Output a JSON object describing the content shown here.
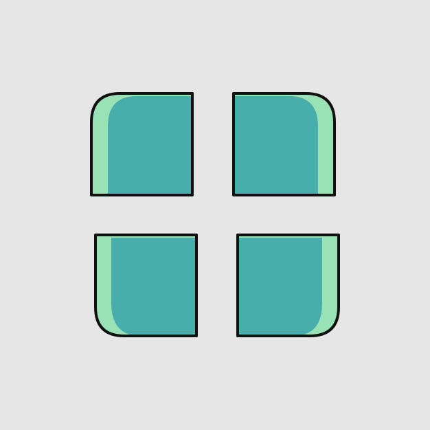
{
  "background_color": "#e6e6e6",
  "icon": {
    "name": "grid-window-icon",
    "colors": {
      "fill_primary": "#47aeac",
      "fill_highlight": "#98e2b5",
      "outline": "#111111"
    }
  }
}
